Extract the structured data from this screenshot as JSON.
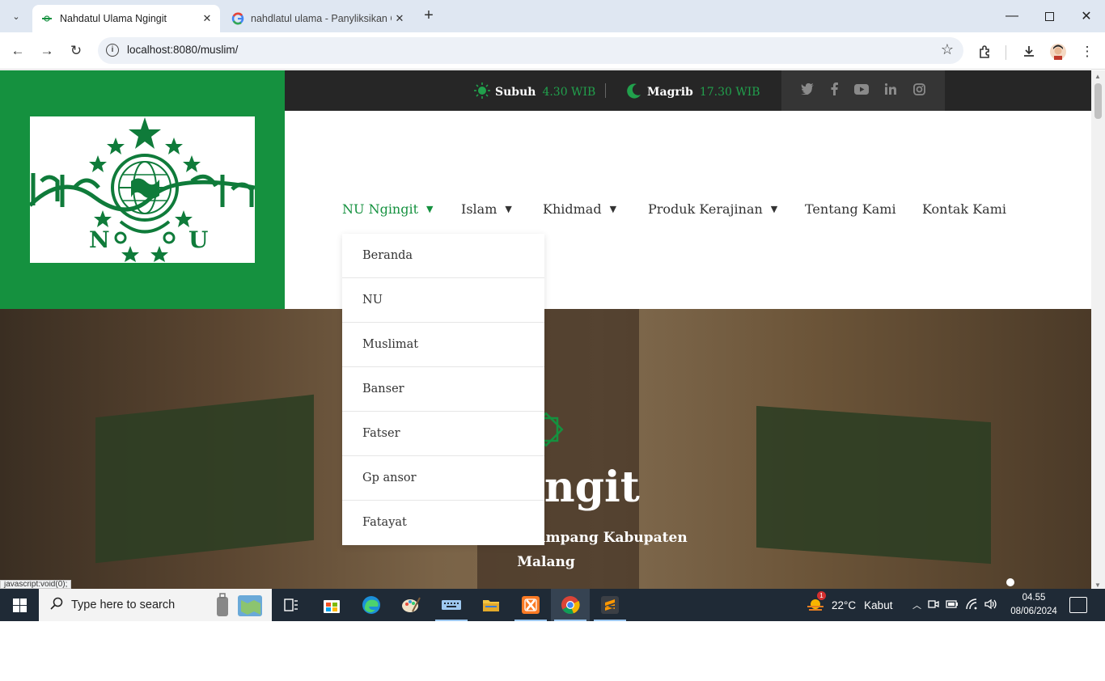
{
  "browser": {
    "tabs": [
      {
        "title": "Nahdatul Ulama Ngingit",
        "active": true
      },
      {
        "title": "nahdlatul ulama - Panyliksikan Google",
        "active": false
      }
    ],
    "url": "localhost:8080/muslim/",
    "status_url": "javascript:void(0);"
  },
  "site": {
    "logo_text": {
      "left": "N",
      "right": "U"
    },
    "prayers": [
      {
        "name": "Subuh",
        "time": "4.30 WIB"
      },
      {
        "name": "Magrib",
        "time": "17.30 WIB"
      }
    ],
    "social_icons": [
      "twitter-icon",
      "facebook-icon",
      "youtube-icon",
      "linkedin-icon",
      "instagram-icon"
    ],
    "menu": [
      {
        "label": "NU Ngingit",
        "has_dropdown": true,
        "active": true
      },
      {
        "label": "Islam",
        "has_dropdown": true
      },
      {
        "label": "Khidmad",
        "has_dropdown": true
      },
      {
        "label": "Produk Kerajinan",
        "has_dropdown": true
      },
      {
        "label": "Tentang Kami",
        "has_dropdown": false
      },
      {
        "label": "Kontak Kami",
        "has_dropdown": false
      }
    ],
    "dropdown": [
      "Beranda",
      "NU",
      "Muslimat",
      "Banser",
      "Fatser",
      "Gp ansor",
      "Fatayat"
    ],
    "hero": {
      "title": "Ngingit",
      "subtitle_line1": "Be Ngingit Kec Tumpang Kabupaten",
      "subtitle_line2": "Malang"
    },
    "colors": {
      "brand_green": "#15913f",
      "topbar": "#262626",
      "accent_time": "#21a04c"
    }
  },
  "taskbar": {
    "search_placeholder": "Type here to search",
    "weather": {
      "temp": "22°C",
      "desc": "Kabut",
      "badge": "1"
    },
    "time": "04.55",
    "date": "08/06/2024"
  }
}
